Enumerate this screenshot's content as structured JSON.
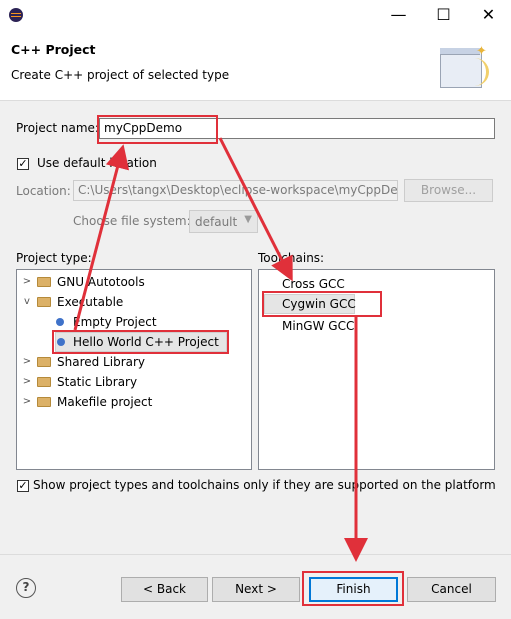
{
  "window": {
    "minimize_label": "—",
    "maximize_label": "☐",
    "close_label": "✕"
  },
  "header": {
    "title": "C++ Project",
    "subtitle": "Create C++ project of selected type"
  },
  "project_name": {
    "label": "Project name:",
    "value": "myCppDemo"
  },
  "default_location": {
    "label": "Use default location",
    "checked": true
  },
  "location": {
    "label": "Location:",
    "value": "C:\\Users\\tangx\\Desktop\\eclipse-workspace\\myCppDer",
    "browse_label": "Browse..."
  },
  "file_system": {
    "label": "Choose file system:",
    "value": "default"
  },
  "project_type": {
    "label": "Project type:",
    "items": [
      {
        "label": "GNU Autotools",
        "kind": "folder",
        "expanded": false
      },
      {
        "label": "Executable",
        "kind": "folder",
        "expanded": true
      },
      {
        "label": "Empty Project",
        "kind": "leaf"
      },
      {
        "label": "Hello World C++ Project",
        "kind": "leaf",
        "selected": true
      },
      {
        "label": "Shared Library",
        "kind": "folder",
        "expanded": false
      },
      {
        "label": "Static Library",
        "kind": "folder",
        "expanded": false
      },
      {
        "label": "Makefile project",
        "kind": "folder",
        "expanded": false
      }
    ]
  },
  "toolchains": {
    "label": "Toolchains:",
    "items": [
      {
        "label": "Cross GCC"
      },
      {
        "label": "Cygwin GCC",
        "selected": true
      },
      {
        "label": "MinGW GCC"
      }
    ]
  },
  "filter": {
    "label": "Show project types and toolchains only if they are supported on the platform",
    "checked": true
  },
  "buttons": {
    "back": "< Back",
    "next": "Next >",
    "finish": "Finish",
    "cancel": "Cancel",
    "help": "?"
  },
  "colors": {
    "annotation": "#e0303a",
    "selection": "#e5e5e5",
    "accent": "#0078d7"
  }
}
